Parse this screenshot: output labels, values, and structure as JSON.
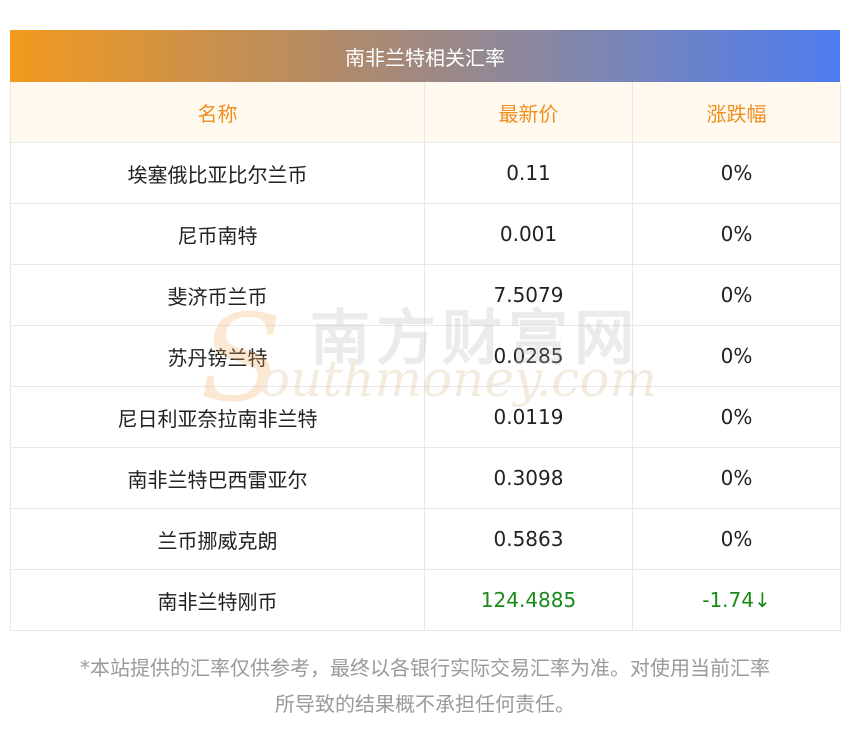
{
  "table": {
    "title": "南非兰特相关汇率",
    "headers": {
      "name": "名称",
      "price": "最新价",
      "change": "涨跌幅"
    },
    "rows": [
      {
        "name": "埃塞俄比亚比尔兰币",
        "price": "0.11",
        "change": "0%",
        "trend": "flat"
      },
      {
        "name": "尼币南特",
        "price": "0.001",
        "change": "0%",
        "trend": "flat"
      },
      {
        "name": "斐济币兰币",
        "price": "7.5079",
        "change": "0%",
        "trend": "flat"
      },
      {
        "name": "苏丹镑兰特",
        "price": "0.0285",
        "change": "0%",
        "trend": "flat"
      },
      {
        "name": "尼日利亚奈拉南非兰特",
        "price": "0.0119",
        "change": "0%",
        "trend": "flat"
      },
      {
        "name": "南非兰特巴西雷亚尔",
        "price": "0.3098",
        "change": "0%",
        "trend": "flat"
      },
      {
        "name": "兰币挪威克朗",
        "price": "0.5863",
        "change": "0%",
        "trend": "flat"
      },
      {
        "name": "南非兰特刚币",
        "price": "124.4885",
        "change": "-1.74",
        "arrow": "↓",
        "trend": "up-color"
      }
    ]
  },
  "watermark": {
    "cn": "南方财富网",
    "en": "outhmoney.com",
    "s": "S"
  },
  "note": {
    "line1": "*本站提供的汇率仅供参考，最终以各银行实际交易汇率为准。对使用当前汇率",
    "line2": "所导致的结果概不承担任何责任。"
  },
  "colors": {
    "header_text": "#f0901e",
    "green": "#1a8a1a",
    "gradient_start": "#f39a1e",
    "gradient_end": "#4d7cf0"
  }
}
